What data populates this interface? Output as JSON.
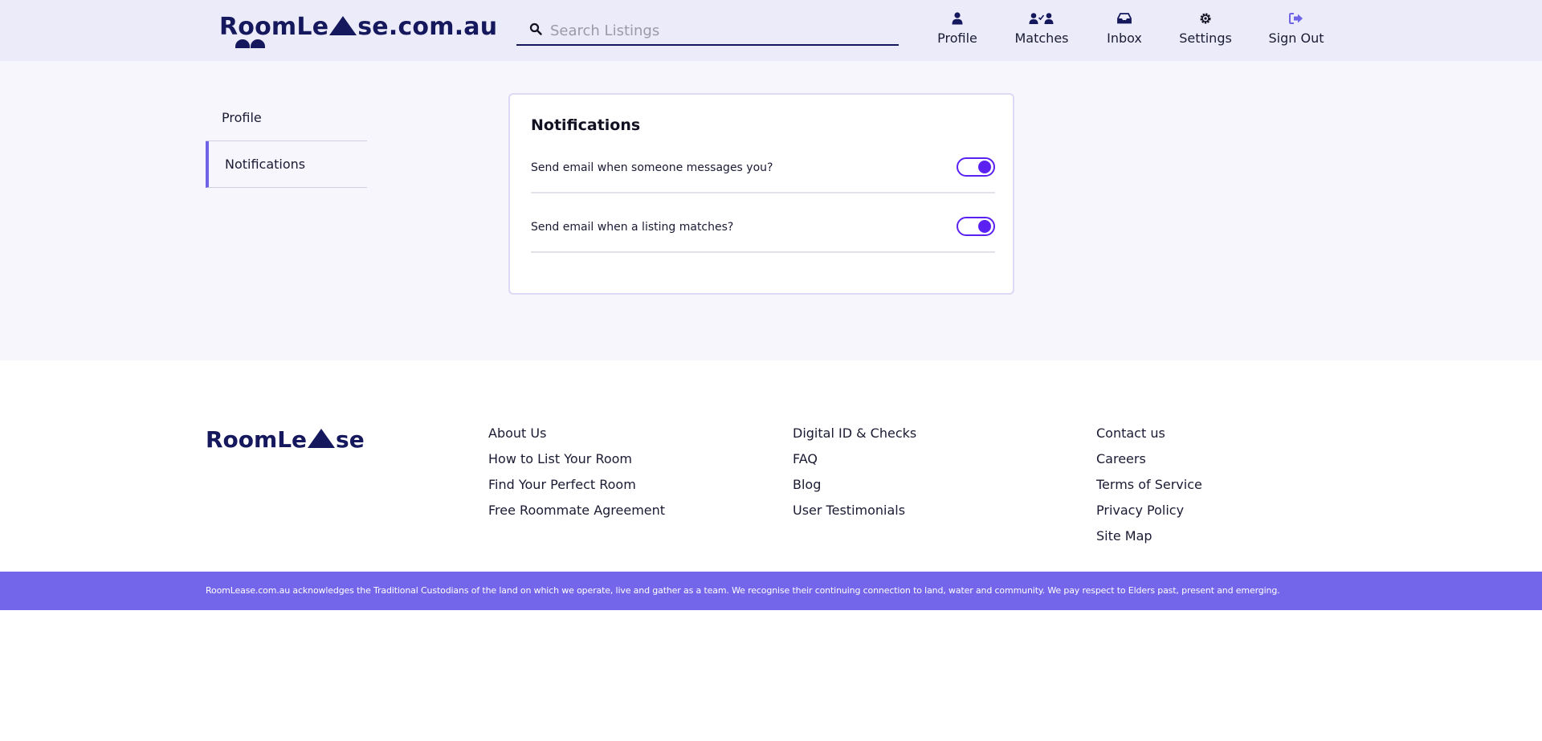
{
  "header": {
    "logo_text_before": "RoomLe",
    "logo_text_after": "se.com.au",
    "search": {
      "placeholder": "Search Listings",
      "value": ""
    },
    "nav": [
      {
        "label": "Profile",
        "icon": "user-icon"
      },
      {
        "label": "Matches",
        "icon": "users-check-icon"
      },
      {
        "label": "Inbox",
        "icon": "inbox-icon"
      },
      {
        "label": "Settings",
        "icon": "gear-icon"
      },
      {
        "label": "Sign Out",
        "icon": "sign-out-icon"
      }
    ]
  },
  "sidebar": {
    "items": [
      {
        "label": "Profile",
        "active": false
      },
      {
        "label": "Notifications",
        "active": true
      }
    ]
  },
  "notifications": {
    "title": "Notifications",
    "settings": [
      {
        "label": "Send email when someone messages you?",
        "enabled": true
      },
      {
        "label": "Send email when a listing matches?",
        "enabled": true
      }
    ]
  },
  "footer": {
    "logo_text_before": "RoomLe",
    "logo_text_after": "se",
    "columns": [
      [
        "About Us",
        "How to List Your Room",
        "Find Your Perfect Room",
        "Free Roommate Agreement"
      ],
      [
        "Digital ID & Checks",
        "FAQ",
        "Blog",
        "User Testimonials"
      ],
      [
        "Contact us",
        "Careers",
        "Terms of Service",
        "Privacy Policy",
        "Site Map"
      ]
    ],
    "acknowledgement": "RoomLease.com.au acknowledges the Traditional Custodians of the land on which we operate, live and gather as a team. We recognise their continuing connection to land, water and community. We pay respect to Elders past, present and emerging."
  },
  "colors": {
    "brand_navy": "#15185c",
    "accent_purple": "#5b21f2",
    "banner_purple": "#7366ea",
    "header_bg": "#ebebfa",
    "main_bg": "#f6f6fc"
  }
}
